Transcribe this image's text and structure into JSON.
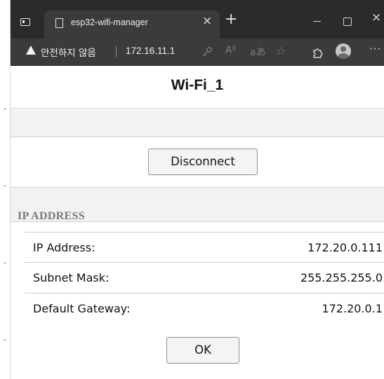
{
  "browser": {
    "tab": {
      "title": "esp32-wifi-manager",
      "close": "×"
    },
    "new_tab": "+",
    "window": {
      "minimize": "–",
      "maximize": "□",
      "close": "×"
    },
    "address_bar": {
      "security_warning": "안전하지 않음",
      "url": "172.16.11.1",
      "read_aloud": "A⁸",
      "translate": "aあ",
      "favorite": "☆",
      "more": "···"
    }
  },
  "page": {
    "title": "Wi-Fi_1",
    "disconnect_label": "Disconnect",
    "section_title": "IP ADDRESS",
    "rows": [
      {
        "label": "IP Address:",
        "value": "172.20.0.111"
      },
      {
        "label": "Subnet Mask:",
        "value": "255.255.255.0"
      },
      {
        "label": "Default Gateway:",
        "value": "172.20.0.1"
      }
    ],
    "ok_label": "OK"
  },
  "colors": {
    "tab_bar": "#2b2b2b",
    "address_bar": "#3b3b3b",
    "band": "#f2f2f2",
    "section_title": "#7a7a7a"
  },
  "icons": [
    "tab-actions-icon",
    "page-icon",
    "close-icon",
    "new-tab-icon",
    "minimize-icon",
    "maximize-icon",
    "warning-icon",
    "key-icon",
    "read-aloud-icon",
    "translate-icon",
    "favorite-icon",
    "extensions-icon",
    "profile-icon",
    "more-icon"
  ]
}
